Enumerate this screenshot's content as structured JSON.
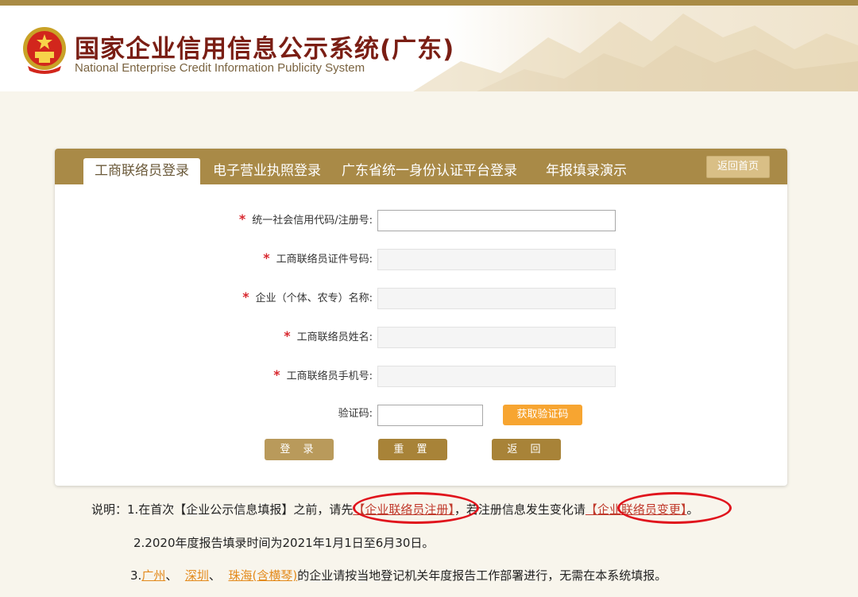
{
  "header": {
    "title": "国家企业信用信息公示系统(广东)",
    "subtitle": "National Enterprise Credit Information Publicity System"
  },
  "tabs": [
    {
      "label": "工商联络员登录",
      "active": true
    },
    {
      "label": "电子营业执照登录"
    },
    {
      "label": "广东省统一身份认证平台登录"
    },
    {
      "label": "年报填录演示"
    }
  ],
  "back_home_label": "返回首页",
  "form": {
    "credit_code_label": "统一社会信用代码/注册号:",
    "id_number_label": "工商联络员证件号码:",
    "enterprise_name_label": "企业（个体、农专）名称:",
    "liaison_name_label": "工商联络员姓名:",
    "phone_label": "工商联络员手机号:",
    "captcha_label": "验证码:",
    "captcha_button": "获取验证码",
    "login_button": "登 录",
    "reset_button": "重 置",
    "back_button": "返 回",
    "required_mark": "*"
  },
  "notes": {
    "line1_prefix": "说明：1.在首次【企业公示信息填报】之前，请先",
    "register_link": "【企业联络员注册】",
    "line1_middle": "，若注册信息发生变化请",
    "change_link": "【企业联络员变更】",
    "line1_suffix": "。",
    "line2": "2.2020年度报告填录时间为2021年1月1日至6月30日。",
    "line3_prefix": "3.",
    "city_guangzhou": "广州",
    "sep1": "、",
    "city_shenzhen": "深圳",
    "sep2": "、",
    "city_zhuhai": "珠海(含横琴)",
    "line3_suffix": "的企业请按当地登记机关年度报告工作部署进行，无需在本系统填报。"
  },
  "colors": {
    "accent": "#a98a47",
    "title": "#7a1e14",
    "required": "#d8282f",
    "captcha_button": "#f7a531",
    "annotation_circle": "#e0131c"
  }
}
